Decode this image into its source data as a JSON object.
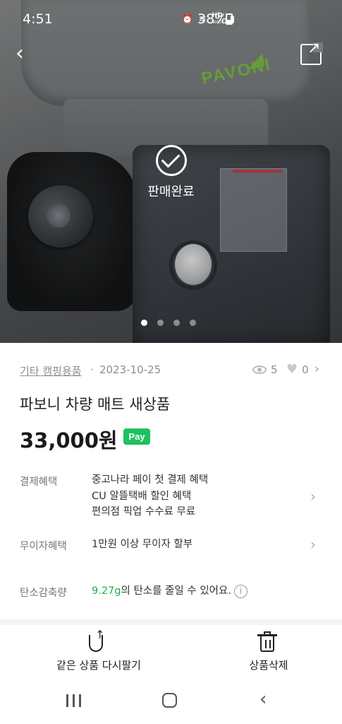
{
  "status_bar": {
    "time": "4:51",
    "network_label": "HD",
    "network_sub": "VoLTE",
    "battery": "38%"
  },
  "hero": {
    "brand_logo": "PAVONI",
    "sold_label": "판매완료",
    "image_count": 4,
    "active_image_index": 0
  },
  "meta": {
    "category": "기타 캠핑용품",
    "separator": "·",
    "date": "2023-10-25",
    "views": "5",
    "likes": "0"
  },
  "product": {
    "title": "파보니 차량 매트 새상품",
    "price": "33,000원",
    "pay_badge": "Pay"
  },
  "benefits": {
    "payment_label": "결제혜택",
    "payment_lines": [
      "중고나라 페이 첫 결제 혜택",
      "CU 알뜰택배 할인 혜택",
      "편의점 픽업 수수료 무료"
    ],
    "installment_label": "무이자혜택",
    "installment_value": "1만원 이상 무이자 할부",
    "carbon_label": "탄소감축량",
    "carbon_amount": "9.27g",
    "carbon_suffix": "의 탄소를 줄일 수 있어요."
  },
  "actions": {
    "relist": "같은 상품 다시팔기",
    "delete": "상품삭제"
  },
  "icons": {
    "back": "chevron-left-icon",
    "share": "share-icon",
    "check": "check-circle-icon",
    "eye": "eye-icon",
    "heart": "heart-icon",
    "info": "info-icon",
    "relist": "relist-arrow-icon",
    "trash": "trash-icon"
  },
  "colors": {
    "accent_green": "#19b24b",
    "pay_badge": "#1ec15f"
  }
}
